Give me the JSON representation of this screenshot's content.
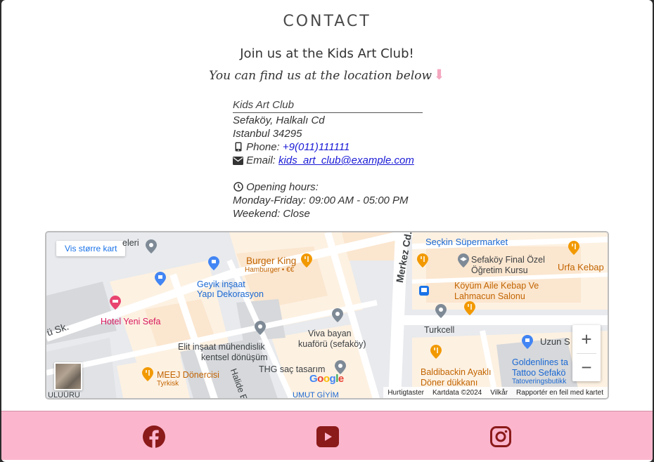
{
  "section": {
    "title": "CONTACT"
  },
  "intro": {
    "heading": "Join us at the Kids Art Club!",
    "tagline": "You can find us at the location below",
    "arrow": "⬇"
  },
  "address": {
    "name": "Kids Art Club",
    "line1": "Sefaköy, Halkalı Cd",
    "line2": "Istanbul 34295",
    "phone_label": "Phone:",
    "phone": "+9(011)111111",
    "email_label": "Email:",
    "email": "kids_art_club@example.com",
    "hours_label": "Opening hours:",
    "hours_weekday": "Monday-Friday: 09:00 AM - 05:00 PM",
    "hours_weekend": "Weekend: Close"
  },
  "map": {
    "larger_map_button": "Vis større kart",
    "zoom_in": "+",
    "zoom_out": "−",
    "google_logo": "Google",
    "attribution": {
      "shortcuts": "Hurtigtaster",
      "map_data": "Kartdata ©2024",
      "terms": "Vilkår",
      "report": "Rapportér en feil med kartet"
    },
    "labels": {
      "burger_king": "Burger King",
      "burger_king_sub": "Hamburger • €€",
      "seckin": "Seçkin Süpermarket",
      "sefakoy_final": "Sefaköy Final Özel",
      "ogretim": "Öğretim Kursu",
      "urfa": "Urfa Kebap",
      "koyum": "Köyüm Aile Kebap Ve",
      "lahmacun": "Lahmacun Salonu",
      "turkcell": "Turkcell",
      "uzun": "Uzun S",
      "geyik": "Geyik inşaat",
      "yapi": "Yapı Dekorasyon",
      "hotel": "Hotel Yeni Sefa",
      "viva": "Viva bayan",
      "kuaforu": "kuaförü (sefaköy)",
      "elit": "Elit inşaat mühendislik",
      "kentsel": "kentsel dönüşüm",
      "thg": "THG saç tasarım",
      "meej": "MEEJ Dönercisi",
      "tyrkisk": "Tyrkisk",
      "baldibackin": "Baldibackin Ayaklı",
      "doner": "Döner dükkanı",
      "goldenlines": "Goldenlines ta",
      "tattoo": "Tattoo Sefakö",
      "tatovering": "Tatoveringsbutikk",
      "merkez": "Merkez Cd.",
      "halide": "Halide E",
      "sk": "ü Sk.",
      "umut": "UMUT GİYİM",
      "leri": "eleri",
      "uru": "ULUÜRU"
    }
  },
  "footer": {
    "icons": [
      "facebook-icon",
      "youtube-icon",
      "instagram-icon"
    ],
    "icon_color": "#8b1a1a",
    "background": "#fbb6cd"
  }
}
